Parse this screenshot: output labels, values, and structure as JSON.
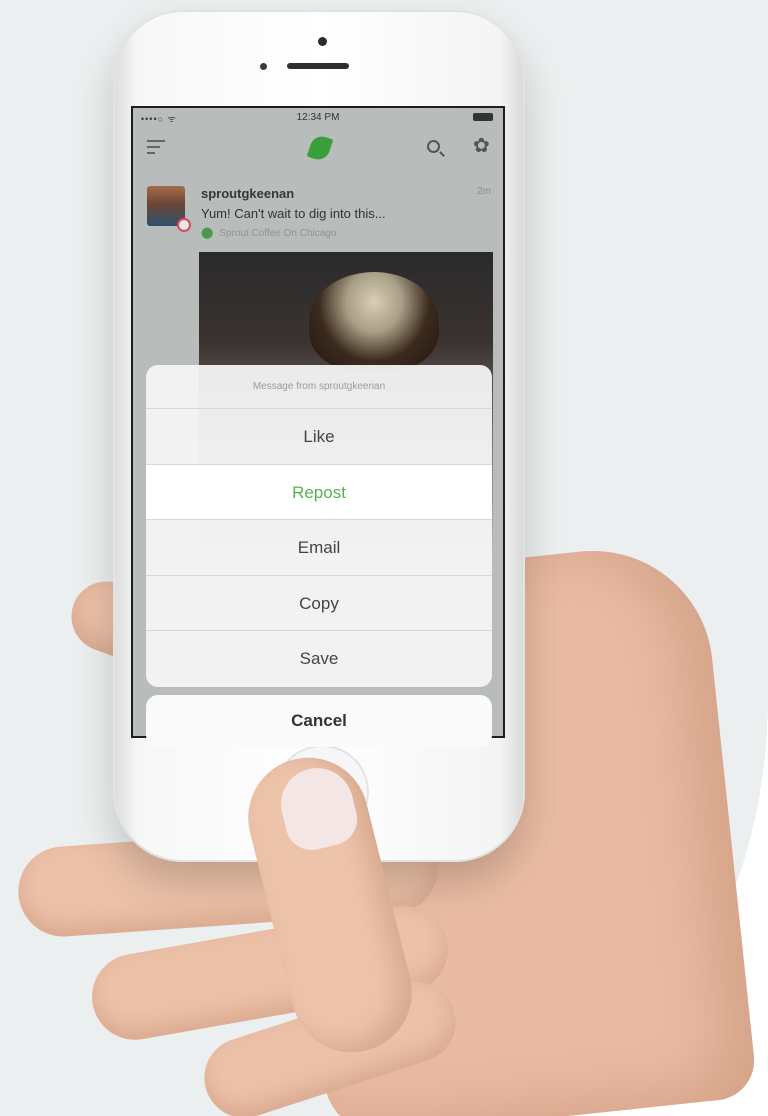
{
  "status_bar": {
    "signal": "••••○ ᯤ",
    "time": "12:34 PM"
  },
  "nav": {
    "menu_icon": "menu-icon",
    "logo_icon": "leaf-icon",
    "search_icon": "search-icon",
    "settings_icon": "gear-icon",
    "gear_glyph": "✿"
  },
  "post": {
    "username": "sproutgkeenan",
    "text": "Yum! Can't wait to dig into this...",
    "time_ago": "2m",
    "location": "Sprout Coffee On Chicago"
  },
  "action_sheet": {
    "title": "Message from sproutgkeenan",
    "items": [
      "Like",
      "Repost",
      "Email",
      "Copy",
      "Save"
    ],
    "highlighted": "Repost",
    "cancel_label": "Cancel"
  },
  "colors": {
    "accent_green": "#53b14f",
    "logo_green": "#3a9e3a"
  }
}
